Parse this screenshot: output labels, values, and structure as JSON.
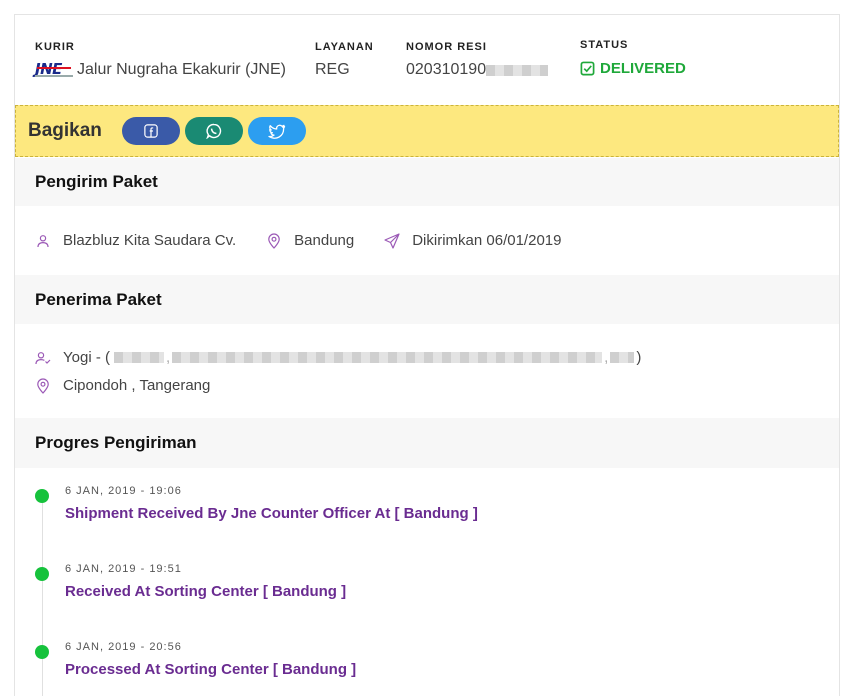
{
  "header": {
    "kurir_label": "KURIR",
    "kurir_value": "Jalur Nugraha Ekakurir (JNE)",
    "kurir_logo_text": "JNE",
    "layanan_label": "LAYANAN",
    "layanan_value": "REG",
    "resi_label": "NOMOR RESI",
    "resi_value": "020310190",
    "status_label": "STATUS",
    "status_value": "DELIVERED",
    "status_icon": "check-square-icon",
    "status_color": "#1fa83a"
  },
  "share": {
    "title": "Bagikan",
    "buttons": [
      {
        "name": "facebook",
        "icon": "facebook-icon",
        "color": "#3a5aa8"
      },
      {
        "name": "whatsapp",
        "icon": "whatsapp-icon",
        "color": "#1a8a73"
      },
      {
        "name": "twitter",
        "icon": "twitter-icon",
        "color": "#2c9ef0"
      }
    ],
    "background": "#fde87f"
  },
  "sender": {
    "title": "Pengirim Paket",
    "name": "Blazbluz Kita Saudara Cv.",
    "city": "Bandung",
    "sent": "Dikirimkan 06/01/2019"
  },
  "receiver": {
    "title": "Penerima Paket",
    "name_prefix": "Yogi - (",
    "name_suffix": ")",
    "separator": ",",
    "location": "Cipondoh , Tangerang"
  },
  "progress": {
    "title": "Progres Pengiriman",
    "accent": "#6a2c91",
    "dot_color": "#16c23c",
    "items": [
      {
        "time": "6 JAN, 2019 - 19:06",
        "desc": "Shipment Received By Jne Counter Officer At [ Bandung ]"
      },
      {
        "time": "6 JAN, 2019 - 19:51",
        "desc": "Received At Sorting Center [ Bandung ]"
      },
      {
        "time": "6 JAN, 2019 - 20:56",
        "desc": "Processed At Sorting Center [ Bandung ]"
      }
    ]
  }
}
